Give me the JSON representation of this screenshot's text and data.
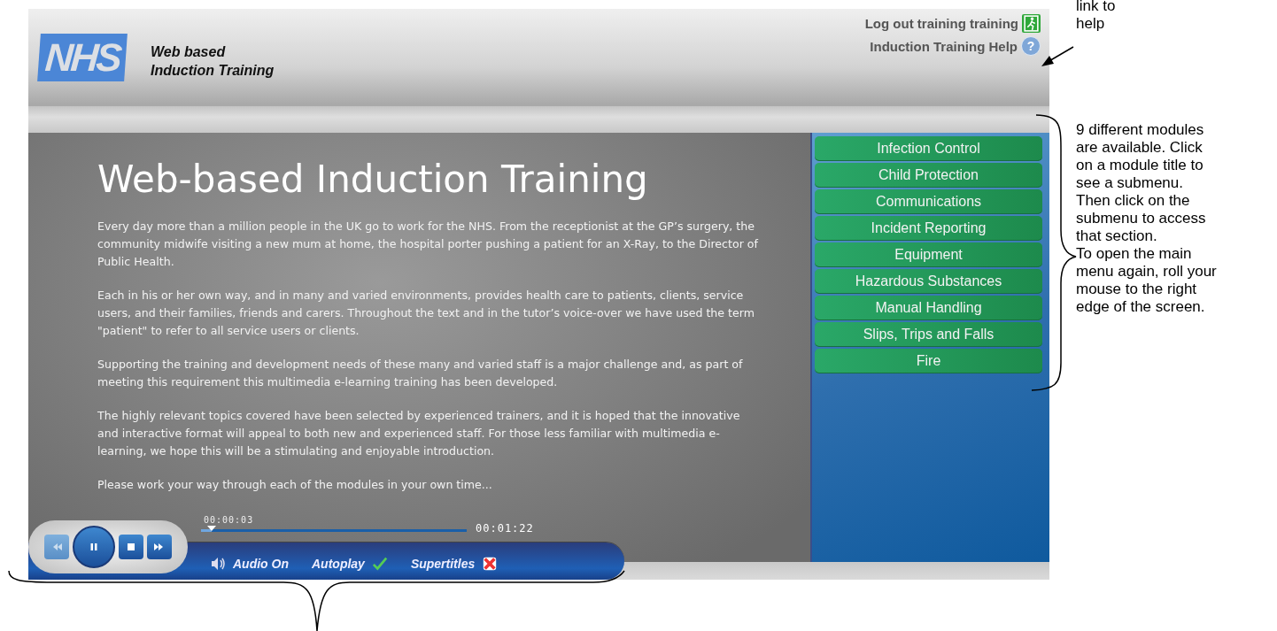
{
  "header": {
    "logo": "NHS",
    "app_title": [
      "Web based",
      "Induction Training"
    ],
    "links": [
      {
        "kind": "logout",
        "label": "Log out training training"
      },
      {
        "kind": "help",
        "label": "Induction Training Help",
        "icon": "?"
      }
    ]
  },
  "content": {
    "title": "Web-based Induction Training",
    "paragraphs": [
      "Every day more than a million people in the UK go to work for the NHS. From the receptionist at the GP’s surgery, the community midwife visiting a new mum at home, the hospital porter pushing a patient for an X-Ray, to the Director of Public Health.",
      "Each in his or her own way, and in many and varied environments, provides health care to patients, clients, service users, and their families, friends and carers. Throughout the text and in the tutor’s voice-over we have used the term \"patient\" to refer to all service users or clients.",
      "Supporting the training and development needs of these many and varied staff is a major challenge and, as part of meeting this requirement this multimedia e-learning training has been developed.",
      "The highly relevant topics covered have been selected by experienced trainers, and it is hoped that the innovative and interactive format will appeal to both new and experienced staff. For those less familiar with multimedia e-learning, we hope this will be a stimulating and enjoyable introduction.",
      "Please work your way through each of the modules in your own time..."
    ]
  },
  "modules": [
    "Infection Control",
    "Child Protection",
    "Communications",
    "Incident Reporting",
    "Equipment",
    "Hazardous Substances",
    "Manual Handling",
    "Slips, Trips and Falls",
    "Fire"
  ],
  "player": {
    "elapsed": "00:00:03",
    "total": "00:01:22",
    "level": 0.04,
    "controls": [
      {
        "kind": "rewind"
      },
      {
        "kind": "pause"
      },
      {
        "kind": "stop"
      },
      {
        "kind": "forward"
      }
    ],
    "options": [
      {
        "kind": "audio",
        "label": "Audio On",
        "on": true
      },
      {
        "kind": "autoplay",
        "label": "Autoplay",
        "on": true
      },
      {
        "kind": "supertitles",
        "label": "Supertitles",
        "on": false
      }
    ]
  },
  "annotations": [
    {
      "kind": "help",
      "text": "link to help"
    },
    {
      "kind": "modules",
      "text": "9 different modules are available. Click on a module title to see a submenu. Then click on the submenu to access that section."
    },
    {
      "kind": "modules",
      "text": "To open the main menu again, roll your mouse to the right edge of the screen."
    }
  ]
}
